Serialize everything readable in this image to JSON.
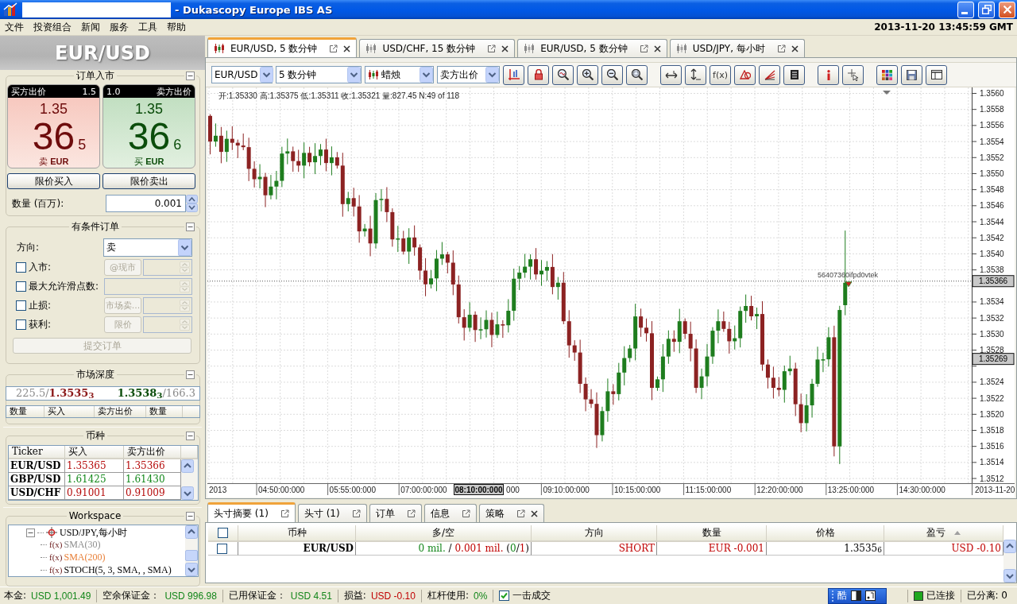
{
  "window": {
    "title": "- Dukascopy Europe IBS AS"
  },
  "menu": {
    "items": [
      "文件",
      "投资组合",
      "新闻",
      "服务",
      "工具",
      "帮助"
    ],
    "clock": "2013-11-20 13:45:59 GMT"
  },
  "instrument_header": "EUR/USD",
  "order_entry": {
    "title": "订单入市",
    "expanded": true,
    "tiles": [
      {
        "kind": "sell",
        "heading": "买方出价",
        "spread": "1.5",
        "big_figure": "1.35",
        "pips": "36",
        "pipette": "5",
        "action": "卖",
        "currency": "EUR"
      },
      {
        "kind": "buy",
        "heading": "卖方出价",
        "spread": "1.0",
        "big_figure": "1.35",
        "pips": "36",
        "pipette": "6",
        "action": "买",
        "currency": "EUR"
      }
    ],
    "buttons": [
      "限价买入",
      "限价卖出"
    ],
    "amount": {
      "label": "数量 (百万):",
      "value": "0.001"
    }
  },
  "conditional_order": {
    "title": "有条件订单",
    "expanded": true,
    "direction": {
      "label": "方向:",
      "value": "卖"
    },
    "rows": [
      {
        "kind": "button",
        "label": "入市:",
        "checked": false,
        "button": "@现市"
      },
      {
        "kind": "field",
        "label": "最大允许滑点数:",
        "checked": false
      },
      {
        "kind": "button",
        "label": "止损:",
        "checked": false,
        "button": "市场卖..."
      },
      {
        "kind": "button",
        "label": "获利:",
        "checked": false,
        "button": "限价"
      }
    ],
    "submit": {
      "label": "提交订单",
      "disabled": true
    }
  },
  "market_depth": {
    "title": "市场深度",
    "expanded": true,
    "bid": {
      "volume": "225.5/",
      "price": "1.3535",
      "pipette": "3"
    },
    "ask": {
      "price": "1.3538",
      "pipette": "3",
      "volume": "/166.3"
    },
    "columns": [
      "数量",
      "买入",
      "卖方出价",
      "数量"
    ]
  },
  "instruments": {
    "title": "币种",
    "expanded": true,
    "columns": [
      "Ticker",
      "买入",
      "卖方出价"
    ],
    "rows": [
      {
        "ticker": "EUR/USD",
        "bid": "1.35365",
        "ask": "1.35366",
        "color": "#b50a0a"
      },
      {
        "ticker": "GBP/USD",
        "bid": "1.61425",
        "ask": "1.61430",
        "color": "#12881a"
      },
      {
        "ticker": "USD/CHF",
        "bid": "0.91001",
        "ask": "0.91009",
        "color": "#b50a0a"
      }
    ]
  },
  "workspace": {
    "title": "Workspace",
    "expanded": true,
    "tree": [
      {
        "label": "USD/JPY,每小时",
        "expanded": true,
        "children": [
          {
            "prefix": "f(x)",
            "label": "SMA(30)",
            "color": "#8c8c8c"
          },
          {
            "prefix": "f(x)",
            "label": "SMA(200)",
            "color": "#e8803a"
          },
          {
            "prefix": "f(x)",
            "label": "STOCH(5, 3, SMA, , SMA)",
            "color": "#000000"
          }
        ]
      }
    ]
  },
  "chart_tabs": [
    {
      "label": "EUR/USD, 5 数分钟",
      "selected": true
    },
    {
      "label": "USD/CHF, 15 数分钟",
      "selected": false
    },
    {
      "label": "EUR/USD, 5 数分钟",
      "selected": false
    },
    {
      "label": "USD/JPY, 每小时",
      "selected": false
    }
  ],
  "chart_toolbar": {
    "instrument": "EUR/USD",
    "period": "5 数分钟",
    "chart_type": "蜡烛",
    "price_side": "卖方出价",
    "function_button": "f(x)"
  },
  "chart": {
    "info_line": "开:1.35330 高:1.35375 低:1.35311 收:1.35321 量:827.45 N:49 of 118",
    "order_label": "56407360ifpd0vtek",
    "price_tags": [
      "1.35366",
      "1.35269"
    ],
    "y_axis_ticks": [
      {
        "kind": "label",
        "text": "1.3560"
      },
      {
        "kind": "label",
        "text": "1.3558"
      },
      {
        "kind": "label",
        "text": "1.3556"
      },
      {
        "kind": "label",
        "text": "1.3554"
      },
      {
        "kind": "label",
        "text": "1.3552"
      },
      {
        "kind": "label",
        "text": "1.3550"
      },
      {
        "kind": "label",
        "text": "1.3548"
      },
      {
        "kind": "label",
        "text": "1.3546"
      },
      {
        "kind": "label",
        "text": "1.3544"
      },
      {
        "kind": "label",
        "text": "1.3542"
      },
      {
        "kind": "label",
        "text": "1.3540"
      },
      {
        "kind": "label",
        "text": "1.3538"
      },
      {
        "kind": "covered"
      },
      {
        "kind": "label",
        "text": "1.3534"
      },
      {
        "kind": "label",
        "text": "1.3532"
      },
      {
        "kind": "label",
        "text": "1.3530"
      },
      {
        "kind": "label",
        "text": "1.3528"
      },
      {
        "kind": "covered"
      },
      {
        "kind": "label",
        "text": "1.3524"
      },
      {
        "kind": "label",
        "text": "1.3522"
      },
      {
        "kind": "label",
        "text": "1.3520"
      },
      {
        "kind": "label",
        "text": "1.3518"
      },
      {
        "kind": "label",
        "text": "1.3516"
      },
      {
        "kind": "label",
        "text": "1.3514"
      },
      {
        "kind": "label",
        "text": "1.3512"
      }
    ],
    "x_axis": {
      "start": "2013",
      "labels": [
        {
          "text": "04:50:00:000",
          "kind": "full"
        },
        {
          "text": "05:55:00:000",
          "kind": "full"
        },
        {
          "text": "07:00:00:000",
          "kind": "full"
        },
        {
          "text": "000",
          "kind": "tail"
        },
        {
          "text": "09:10:00:000",
          "kind": "full"
        },
        {
          "text": "10:15:00:000",
          "kind": "full"
        },
        {
          "text": "11:15:00:000",
          "kind": "full"
        },
        {
          "text": "12:20:00:000",
          "kind": "full"
        },
        {
          "text": "13:25:00:000",
          "kind": "full"
        },
        {
          "text": "14:30:00:000",
          "kind": "full"
        }
      ],
      "cursor": "08:10:00:000",
      "date": "2013-11-20"
    }
  },
  "positions": {
    "tabs": [
      {
        "label": "头寸摘要 (1)",
        "selected": true,
        "closable": false
      },
      {
        "label": "头寸 (1)",
        "selected": false,
        "closable": false
      },
      {
        "label": "订单",
        "selected": false,
        "closable": false
      },
      {
        "label": "信息",
        "selected": false,
        "closable": false
      },
      {
        "label": "策略",
        "selected": false,
        "closable": true
      }
    ],
    "all_checked": false,
    "columns": [
      {
        "label": "币种",
        "sorted": false
      },
      {
        "label": "多/空",
        "sorted": false
      },
      {
        "label": "方向",
        "sorted": false
      },
      {
        "label": "数量",
        "sorted": false
      },
      {
        "label": "价格",
        "sorted": false
      },
      {
        "label": "盈亏",
        "sorted": true
      }
    ],
    "rows": [
      {
        "checked": false,
        "instrument": "EUR/USD",
        "long_short": [
          {
            "text": "0 mil.",
            "color": "#13861a"
          },
          {
            "text": " / "
          },
          {
            "text": "0.001 mil.",
            "color": "#c00000"
          },
          {
            "text": " ("
          },
          {
            "text": "0",
            "color": "#13861a"
          },
          {
            "text": "/"
          },
          {
            "text": "1",
            "color": "#c00000"
          },
          {
            "text": ")"
          }
        ],
        "direction": {
          "text": "SHORT",
          "color": "#c00000"
        },
        "amount": {
          "text": "EUR -0.001",
          "color": "#c00000"
        },
        "price": "1.3535$_{6}$",
        "pnl": {
          "text": "USD -0.10",
          "color": "#c00000"
        }
      }
    ]
  },
  "status_bar": {
    "items": [
      {
        "label": "本金:",
        "value": "USD 1,001.49",
        "color": "#13861a"
      },
      {
        "label": "空余保证金：",
        "value": "USD 996.98",
        "color": "#13861a"
      },
      {
        "label": "已用保证金：",
        "value": "USD 4.51",
        "color": "#13861a"
      },
      {
        "label": "损益:",
        "value": "USD -0.10",
        "color": "#c00000"
      },
      {
        "label": "杠杆使用:",
        "value": "0%",
        "color": "#13861a"
      }
    ],
    "one_click": {
      "label": "一击成交",
      "checked": true
    },
    "ime": "酷",
    "connection": {
      "label": "已连接",
      "connected": true
    },
    "detached": "已分离: 0"
  }
}
